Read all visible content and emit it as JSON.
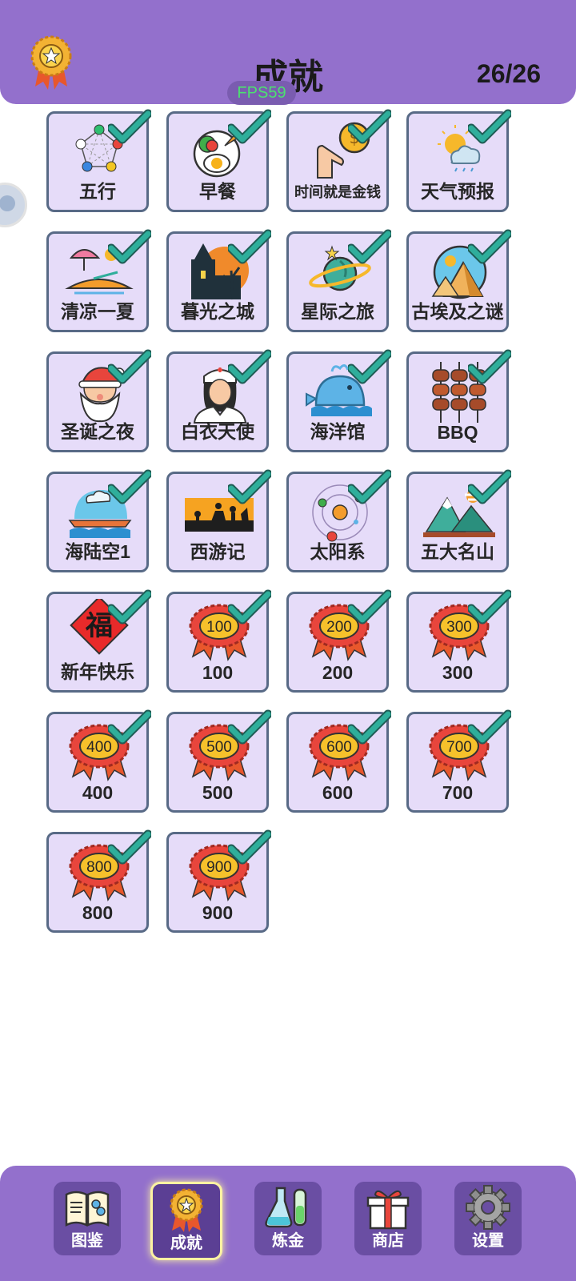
{
  "header": {
    "title": "成就",
    "count": "26/26",
    "fps": "FPS59"
  },
  "colors": {
    "header": "#9370cc",
    "card_bg": "#e6dcf9",
    "card_border": "#586a86",
    "check": "#2fae9b",
    "fps_text": "#4ce070"
  },
  "achievements": [
    {
      "label": "五行",
      "icon": "five-elements-icon"
    },
    {
      "label": "早餐",
      "icon": "breakfast-icon"
    },
    {
      "label": "时间就是金钱",
      "icon": "time-is-money-icon"
    },
    {
      "label": "天气预报",
      "icon": "weather-icon"
    },
    {
      "label": "清凉一夏",
      "icon": "summer-island-icon"
    },
    {
      "label": "暮光之城",
      "icon": "twilight-castle-icon"
    },
    {
      "label": "星际之旅",
      "icon": "planet-icon"
    },
    {
      "label": "古埃及之谜",
      "icon": "pyramid-icon"
    },
    {
      "label": "圣诞之夜",
      "icon": "santa-icon"
    },
    {
      "label": "白衣天使",
      "icon": "nurse-icon"
    },
    {
      "label": "海洋馆",
      "icon": "whale-icon"
    },
    {
      "label": "BBQ",
      "icon": "bbq-icon"
    },
    {
      "label": "海陆空1",
      "icon": "sea-land-air-icon"
    },
    {
      "label": "西游记",
      "icon": "journey-west-icon"
    },
    {
      "label": "太阳系",
      "icon": "solar-system-icon"
    },
    {
      "label": "五大名山",
      "icon": "mountains-icon"
    },
    {
      "label": "新年快乐",
      "icon": "fu-icon",
      "glyph": "福"
    },
    {
      "label": "100",
      "icon": "ribbon-badge-icon",
      "badge": "100"
    },
    {
      "label": "200",
      "icon": "ribbon-badge-icon",
      "badge": "200"
    },
    {
      "label": "300",
      "icon": "ribbon-badge-icon",
      "badge": "300"
    },
    {
      "label": "400",
      "icon": "ribbon-badge-icon",
      "badge": "400"
    },
    {
      "label": "500",
      "icon": "ribbon-badge-icon",
      "badge": "500"
    },
    {
      "label": "600",
      "icon": "ribbon-badge-icon",
      "badge": "600"
    },
    {
      "label": "700",
      "icon": "ribbon-badge-icon",
      "badge": "700"
    },
    {
      "label": "800",
      "icon": "ribbon-badge-icon",
      "badge": "800"
    },
    {
      "label": "900",
      "icon": "ribbon-badge-icon",
      "badge": "900"
    }
  ],
  "nav": [
    {
      "label": "图鉴",
      "icon": "book-icon",
      "active": false
    },
    {
      "label": "成就",
      "icon": "medal-icon",
      "active": true
    },
    {
      "label": "炼金",
      "icon": "flask-icon",
      "active": false
    },
    {
      "label": "商店",
      "icon": "gift-icon",
      "active": false
    },
    {
      "label": "设置",
      "icon": "gear-icon",
      "active": false
    }
  ]
}
